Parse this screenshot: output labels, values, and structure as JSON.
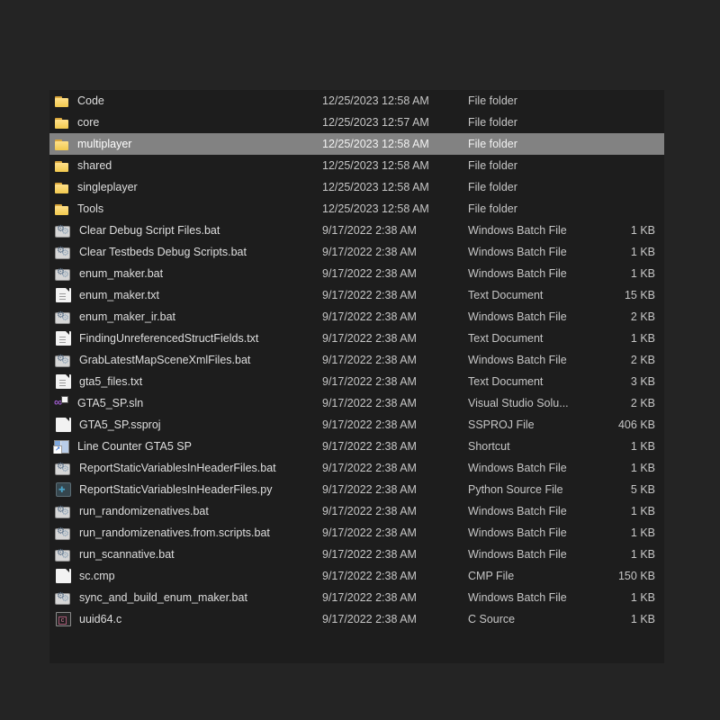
{
  "colors": {
    "outer_background": "#242424",
    "panel_background": "#1d1d1d",
    "selection_background": "#828282",
    "text": "#d2d2d2",
    "selected_text": "#ffffff",
    "folder_yellow": "#f2c94e"
  },
  "file_list": {
    "rows": [
      {
        "name": "Code",
        "date_modified": "12/25/2023 12:58 AM",
        "type": "File folder",
        "size": "",
        "icon": "folder",
        "selected": false
      },
      {
        "name": "core",
        "date_modified": "12/25/2023 12:57 AM",
        "type": "File folder",
        "size": "",
        "icon": "folder",
        "selected": false
      },
      {
        "name": "multiplayer",
        "date_modified": "12/25/2023 12:58 AM",
        "type": "File folder",
        "size": "",
        "icon": "folder",
        "selected": true
      },
      {
        "name": "shared",
        "date_modified": "12/25/2023 12:58 AM",
        "type": "File folder",
        "size": "",
        "icon": "folder",
        "selected": false
      },
      {
        "name": "singleplayer",
        "date_modified": "12/25/2023 12:58 AM",
        "type": "File folder",
        "size": "",
        "icon": "folder",
        "selected": false
      },
      {
        "name": "Tools",
        "date_modified": "12/25/2023 12:58 AM",
        "type": "File folder",
        "size": "",
        "icon": "folder",
        "selected": false
      },
      {
        "name": "Clear Debug Script Files.bat",
        "date_modified": "9/17/2022 2:38 AM",
        "type": "Windows Batch File",
        "size": "1 KB",
        "icon": "bat",
        "selected": false
      },
      {
        "name": "Clear Testbeds Debug Scripts.bat",
        "date_modified": "9/17/2022 2:38 AM",
        "type": "Windows Batch File",
        "size": "1 KB",
        "icon": "bat",
        "selected": false
      },
      {
        "name": "enum_maker.bat",
        "date_modified": "9/17/2022 2:38 AM",
        "type": "Windows Batch File",
        "size": "1 KB",
        "icon": "bat",
        "selected": false
      },
      {
        "name": "enum_maker.txt",
        "date_modified": "9/17/2022 2:38 AM",
        "type": "Text Document",
        "size": "15 KB",
        "icon": "txt",
        "selected": false
      },
      {
        "name": "enum_maker_ir.bat",
        "date_modified": "9/17/2022 2:38 AM",
        "type": "Windows Batch File",
        "size": "2 KB",
        "icon": "bat",
        "selected": false
      },
      {
        "name": "FindingUnreferencedStructFields.txt",
        "date_modified": "9/17/2022 2:38 AM",
        "type": "Text Document",
        "size": "1 KB",
        "icon": "txt",
        "selected": false
      },
      {
        "name": "GrabLatestMapSceneXmlFiles.bat",
        "date_modified": "9/17/2022 2:38 AM",
        "type": "Windows Batch File",
        "size": "2 KB",
        "icon": "bat",
        "selected": false
      },
      {
        "name": "gta5_files.txt",
        "date_modified": "9/17/2022 2:38 AM",
        "type": "Text Document",
        "size": "3 KB",
        "icon": "txt",
        "selected": false
      },
      {
        "name": "GTA5_SP.sln",
        "date_modified": "9/17/2022 2:38 AM",
        "type": "Visual Studio Solu...",
        "size": "2 KB",
        "icon": "sln",
        "selected": false
      },
      {
        "name": "GTA5_SP.ssproj",
        "date_modified": "9/17/2022 2:38 AM",
        "type": "SSPROJ File",
        "size": "406 KB",
        "icon": "file",
        "selected": false
      },
      {
        "name": "Line Counter GTA5 SP",
        "date_modified": "9/17/2022 2:38 AM",
        "type": "Shortcut",
        "size": "1 KB",
        "icon": "shortcut",
        "selected": false
      },
      {
        "name": "ReportStaticVariablesInHeaderFiles.bat",
        "date_modified": "9/17/2022 2:38 AM",
        "type": "Windows Batch File",
        "size": "1 KB",
        "icon": "bat",
        "selected": false
      },
      {
        "name": "ReportStaticVariablesInHeaderFiles.py",
        "date_modified": "9/17/2022 2:38 AM",
        "type": "Python Source File",
        "size": "5 KB",
        "icon": "py",
        "selected": false
      },
      {
        "name": "run_randomizenatives.bat",
        "date_modified": "9/17/2022 2:38 AM",
        "type": "Windows Batch File",
        "size": "1 KB",
        "icon": "bat",
        "selected": false
      },
      {
        "name": "run_randomizenatives.from.scripts.bat",
        "date_modified": "9/17/2022 2:38 AM",
        "type": "Windows Batch File",
        "size": "1 KB",
        "icon": "bat",
        "selected": false
      },
      {
        "name": "run_scannative.bat",
        "date_modified": "9/17/2022 2:38 AM",
        "type": "Windows Batch File",
        "size": "1 KB",
        "icon": "bat",
        "selected": false
      },
      {
        "name": "sc.cmp",
        "date_modified": "9/17/2022 2:38 AM",
        "type": "CMP File",
        "size": "150 KB",
        "icon": "file",
        "selected": false
      },
      {
        "name": "sync_and_build_enum_maker.bat",
        "date_modified": "9/17/2022 2:38 AM",
        "type": "Windows Batch File",
        "size": "1 KB",
        "icon": "bat",
        "selected": false
      },
      {
        "name": "uuid64.c",
        "date_modified": "9/17/2022 2:38 AM",
        "type": "C Source",
        "size": "1 KB",
        "icon": "c",
        "selected": false
      }
    ]
  }
}
